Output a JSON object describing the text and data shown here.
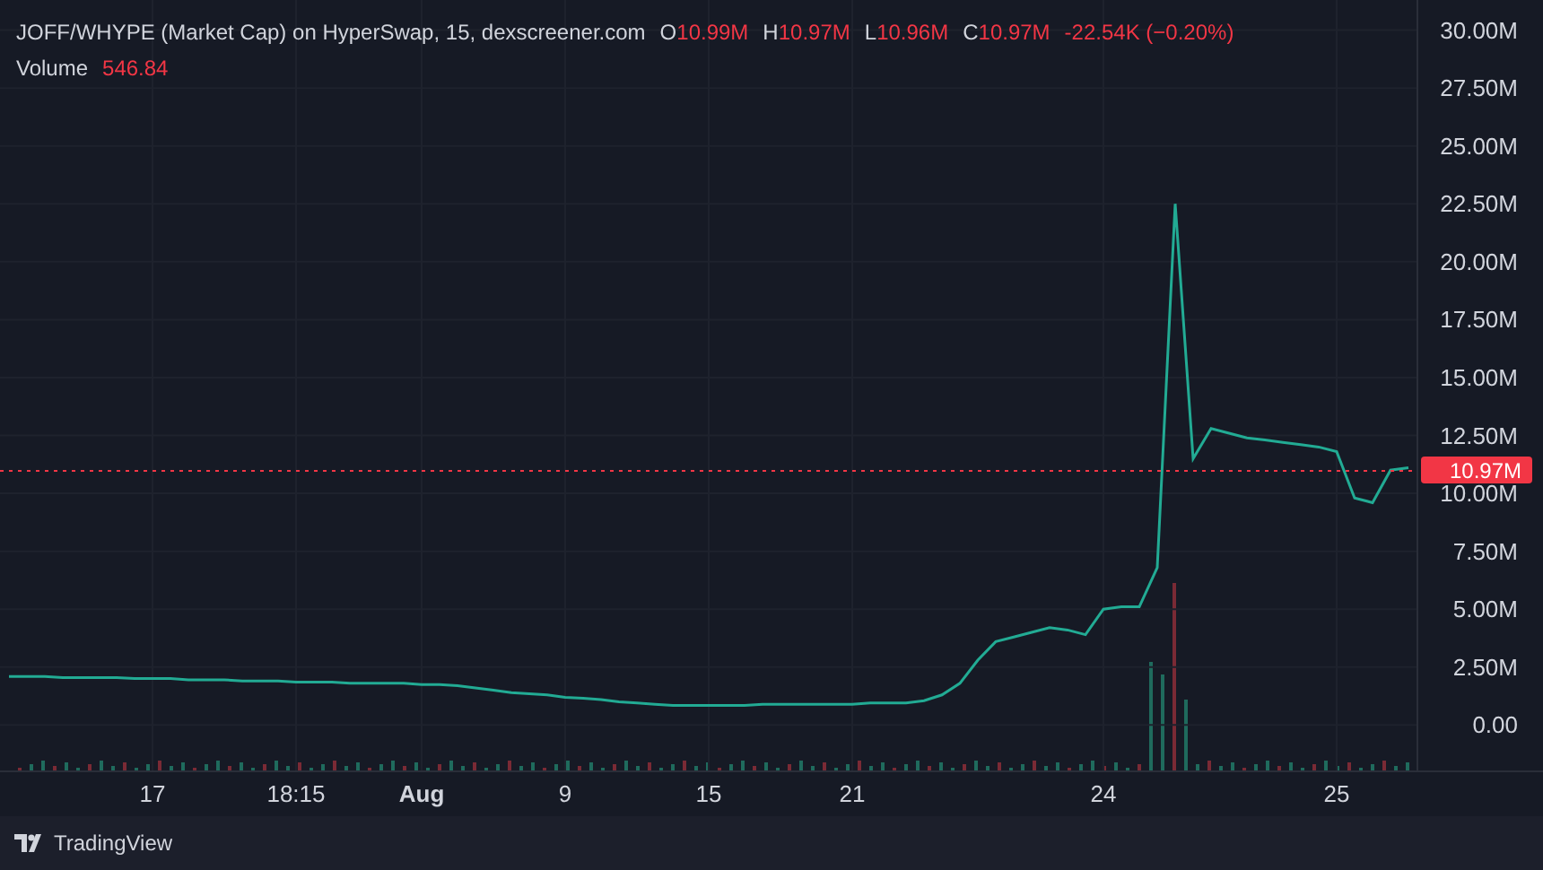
{
  "legend": {
    "title": "JOFF/WHYPE (Market Cap) on HyperSwap, 15, dexscreener.com",
    "ohlc": [
      {
        "label": "O",
        "value": "10.99M"
      },
      {
        "label": "H",
        "value": "10.97M"
      },
      {
        "label": "L",
        "value": "10.96M"
      },
      {
        "label": "C",
        "value": "10.97M"
      }
    ],
    "change": "-22.54K (−0.20%)",
    "volume": {
      "label": "Volume",
      "value": "546.84"
    }
  },
  "chart_data": {
    "type": "line",
    "ylim": [
      -2.0,
      31.3
    ],
    "categories": [
      null,
      null,
      null,
      null,
      null,
      null,
      null,
      null,
      "17",
      null,
      null,
      null,
      null,
      null,
      null,
      null,
      "18:15",
      null,
      null,
      null,
      null,
      null,
      null,
      "Aug",
      null,
      null,
      null,
      null,
      null,
      null,
      null,
      "9",
      null,
      null,
      null,
      null,
      null,
      null,
      null,
      "15",
      null,
      null,
      null,
      null,
      null,
      null,
      null,
      "21",
      null,
      null,
      null,
      null,
      null,
      null,
      null,
      null,
      null,
      null,
      null,
      null,
      null,
      "24",
      null,
      null,
      null,
      null,
      null,
      null,
      null,
      null,
      null,
      null,
      null,
      null,
      "25",
      null,
      null,
      null,
      null
    ],
    "series": [
      {
        "color": "#22ab94",
        "values": [
          2.1,
          2.1,
          2.1,
          2.05,
          2.05,
          2.05,
          2.05,
          2.0,
          2.0,
          2.0,
          1.95,
          1.95,
          1.95,
          1.9,
          1.9,
          1.9,
          1.85,
          1.85,
          1.85,
          1.8,
          1.8,
          1.8,
          1.8,
          1.75,
          1.75,
          1.7,
          1.6,
          1.5,
          1.4,
          1.35,
          1.3,
          1.2,
          1.15,
          1.1,
          1.0,
          0.95,
          0.9,
          0.85,
          0.85,
          0.85,
          0.85,
          0.85,
          0.9,
          0.9,
          0.9,
          0.9,
          0.9,
          0.9,
          0.95,
          0.95,
          0.95,
          1.05,
          1.3,
          1.8,
          2.8,
          3.6,
          3.8,
          4.0,
          4.2,
          4.1,
          3.9,
          5.0,
          5.1,
          5.1,
          6.8,
          22.5,
          11.5,
          12.8,
          12.6,
          12.4,
          12.3,
          12.2,
          12.1,
          12.0,
          11.8,
          9.8,
          9.6,
          11.0,
          11.1
        ]
      }
    ],
    "yticks": [
      {
        "value": 0,
        "label": "0.00"
      },
      {
        "value": 2.5,
        "label": "2.50M"
      },
      {
        "value": 5,
        "label": "5.00M"
      },
      {
        "value": 7.5,
        "label": "7.50M"
      },
      {
        "value": 10,
        "label": "10.00M"
      },
      {
        "value": 12.5,
        "label": "12.50M"
      },
      {
        "value": 15,
        "label": "15.00M"
      },
      {
        "value": 17.5,
        "label": "17.50M"
      },
      {
        "value": 20,
        "label": "20.00M"
      },
      {
        "value": 22.5,
        "label": "22.50M"
      },
      {
        "value": 25,
        "label": "25.00M"
      },
      {
        "value": 27.5,
        "label": "27.50M"
      },
      {
        "value": 30,
        "label": "30.00M"
      }
    ],
    "grid": true,
    "ref_lines": [
      {
        "axis": "y",
        "value": 10.97,
        "label": "10.97M",
        "color": "#f23645"
      }
    ]
  },
  "footer": {
    "brand": "TradingView"
  }
}
